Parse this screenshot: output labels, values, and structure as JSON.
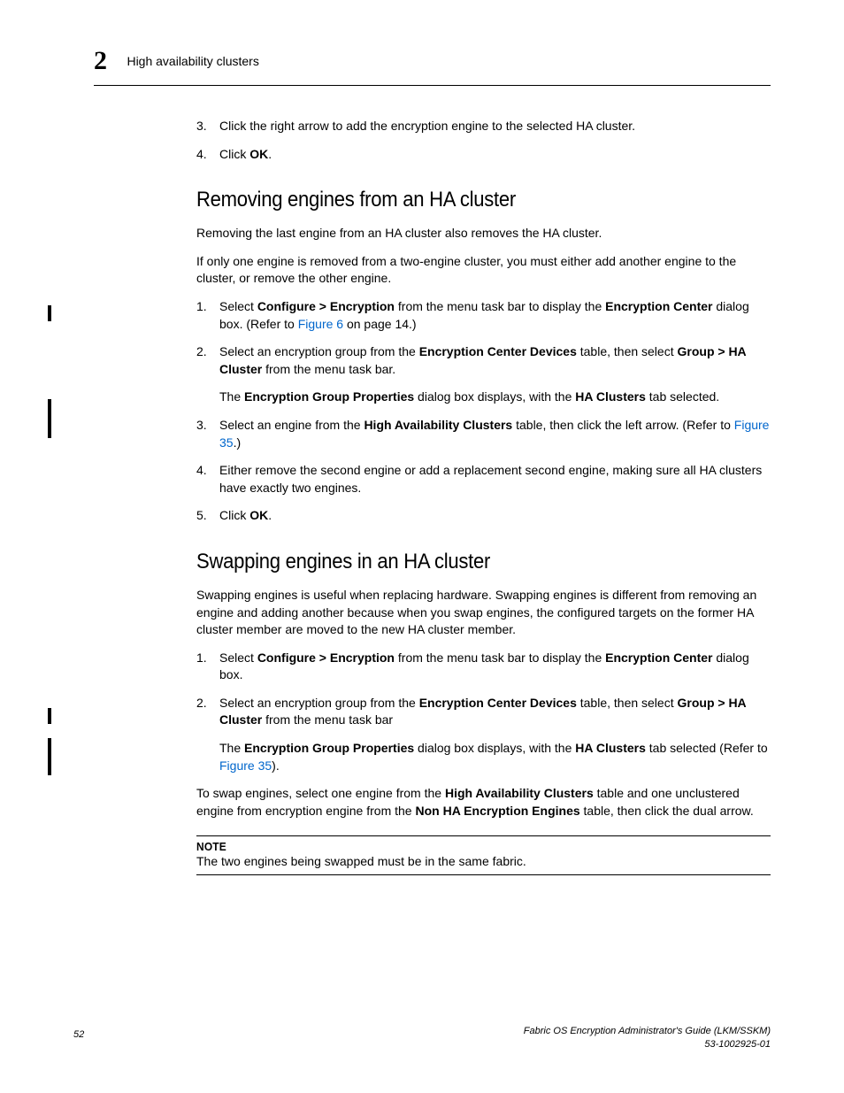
{
  "header": {
    "chapter_number": "2",
    "running_title": "High availability clusters"
  },
  "intro_list": {
    "item3": {
      "num": "3.",
      "text": "Click the right arrow to add the encryption engine to the selected HA cluster."
    },
    "item4": {
      "num": "4.",
      "pre": "Click ",
      "bold": "OK",
      "post": "."
    }
  },
  "section_remove": {
    "heading": "Removing engines from an HA cluster",
    "p1": "Removing the last engine from an HA cluster also removes the HA cluster.",
    "p2": "If only one engine is removed from a two-engine cluster, you must either add another engine to the cluster, or remove the other engine.",
    "items": {
      "i1": {
        "num": "1.",
        "t1": "Select ",
        "b1": "Configure > Encryption",
        "t2": " from the menu task bar to display the ",
        "b2": "Encryption Center",
        "t3": " dialog box. (Refer to ",
        "link": "Figure 6",
        "t4": " on page 14.)"
      },
      "i2": {
        "num": "2.",
        "t1": "Select an encryption group from the ",
        "b1": "Encryption Center Devices",
        "t2": " table, then select ",
        "b2": "Group > HA Cluster",
        "t3": " from the menu task bar.",
        "sub_t1": "The ",
        "sub_b1": "Encryption Group Properties",
        "sub_t2": " dialog box displays, with the ",
        "sub_b2": "HA Clusters",
        "sub_t3": " tab selected."
      },
      "i3": {
        "num": "3.",
        "t1": "Select an engine from the ",
        "b1": "High Availability Clusters",
        "t2": " table, then click the left arrow. (Refer to ",
        "link": "Figure 35",
        "t3": ".)"
      },
      "i4": {
        "num": "4.",
        "text": "Either remove the second engine or add a replacement second engine, making sure all HA clusters have exactly two engines."
      },
      "i5": {
        "num": "5.",
        "pre": "Click ",
        "bold": "OK",
        "post": "."
      }
    }
  },
  "section_swap": {
    "heading": "Swapping engines in an HA cluster",
    "p1": "Swapping engines is useful when replacing hardware. Swapping engines is different from removing an engine and adding another because when you swap engines, the configured targets on the former HA cluster member are moved to the new HA cluster member.",
    "items": {
      "i1": {
        "num": "1.",
        "t1": "Select ",
        "b1": "Configure > Encryption",
        "t2": " from the menu task bar to display the ",
        "b2": "Encryption Center",
        "t3": " dialog box."
      },
      "i2": {
        "num": "2.",
        "t1": "Select an encryption group from the ",
        "b1": "Encryption Center Devices",
        "t2": " table, then select ",
        "b2": "Group > HA Cluster",
        "t3": " from the menu task bar",
        "sub_t1": "The ",
        "sub_b1": "Encryption Group Properties",
        "sub_t2": " dialog box displays, with the ",
        "sub_b2": "HA Clusters",
        "sub_t3": " tab selected (Refer to ",
        "sub_link": "Figure 35",
        "sub_t4": ")."
      }
    },
    "p2_t1": "To swap engines, select one engine from the ",
    "p2_b1": "High Availability Clusters",
    "p2_t2": " table and one unclustered engine from encryption engine from the ",
    "p2_b2": "Non HA Encryption Engines",
    "p2_t3": " table, then click the dual arrow.",
    "note_label": "NOTE",
    "note_body": "The two engines being swapped must be in the same fabric."
  },
  "footer": {
    "page_number": "52",
    "doc_title": "Fabric OS Encryption Administrator's Guide  (LKM/SSKM)",
    "doc_number": "53-1002925-01"
  }
}
